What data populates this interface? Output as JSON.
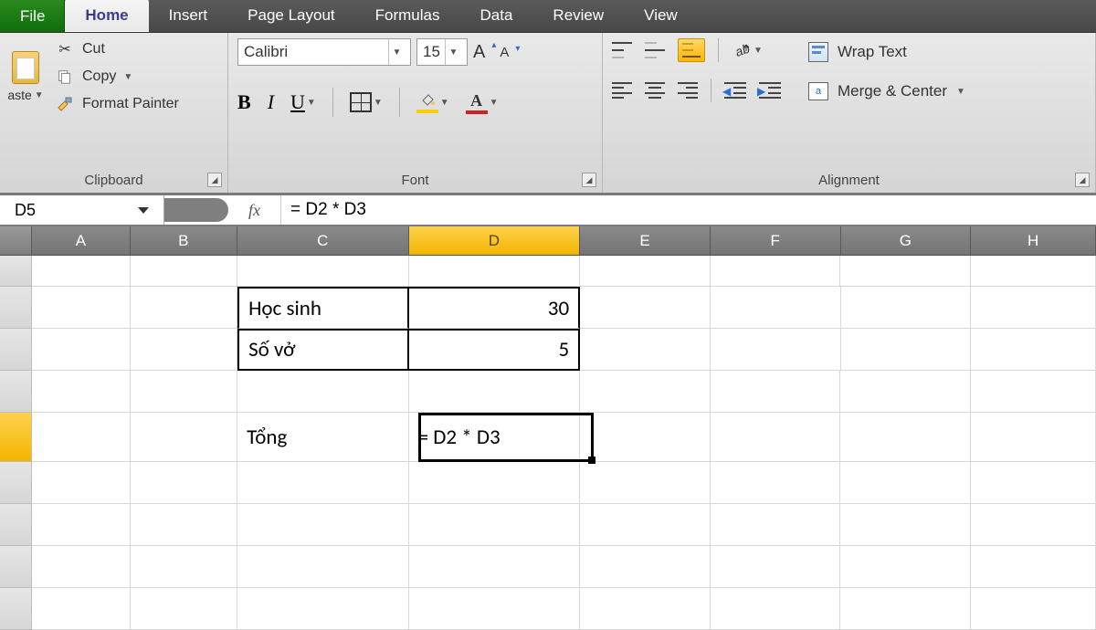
{
  "tabs": {
    "file": "File",
    "home": "Home",
    "insert": "Insert",
    "page_layout": "Page Layout",
    "formulas": "Formulas",
    "data": "Data",
    "review": "Review",
    "view": "View"
  },
  "ribbon": {
    "clipboard": {
      "paste": "aste",
      "cut": "Cut",
      "copy": "Copy",
      "format_painter": "Format Painter",
      "group_label": "Clipboard"
    },
    "font": {
      "font_name": "Calibri",
      "font_size": "15",
      "group_label": "Font"
    },
    "alignment": {
      "wrap_text": "Wrap Text",
      "merge_center": "Merge & Center",
      "group_label": "Alignment"
    }
  },
  "formula_bar": {
    "name_box": "D5",
    "fx": "fx",
    "formula": "= D2 * D3"
  },
  "columns": [
    "A",
    "B",
    "C",
    "D",
    "E",
    "F",
    "G",
    "H"
  ],
  "selected_column": "D",
  "cells": {
    "C2": "Học  sinh",
    "D2": "30",
    "C3": "Số vở",
    "D3": "5",
    "C5": "Tổng",
    "D5": "= D2 * D3"
  }
}
